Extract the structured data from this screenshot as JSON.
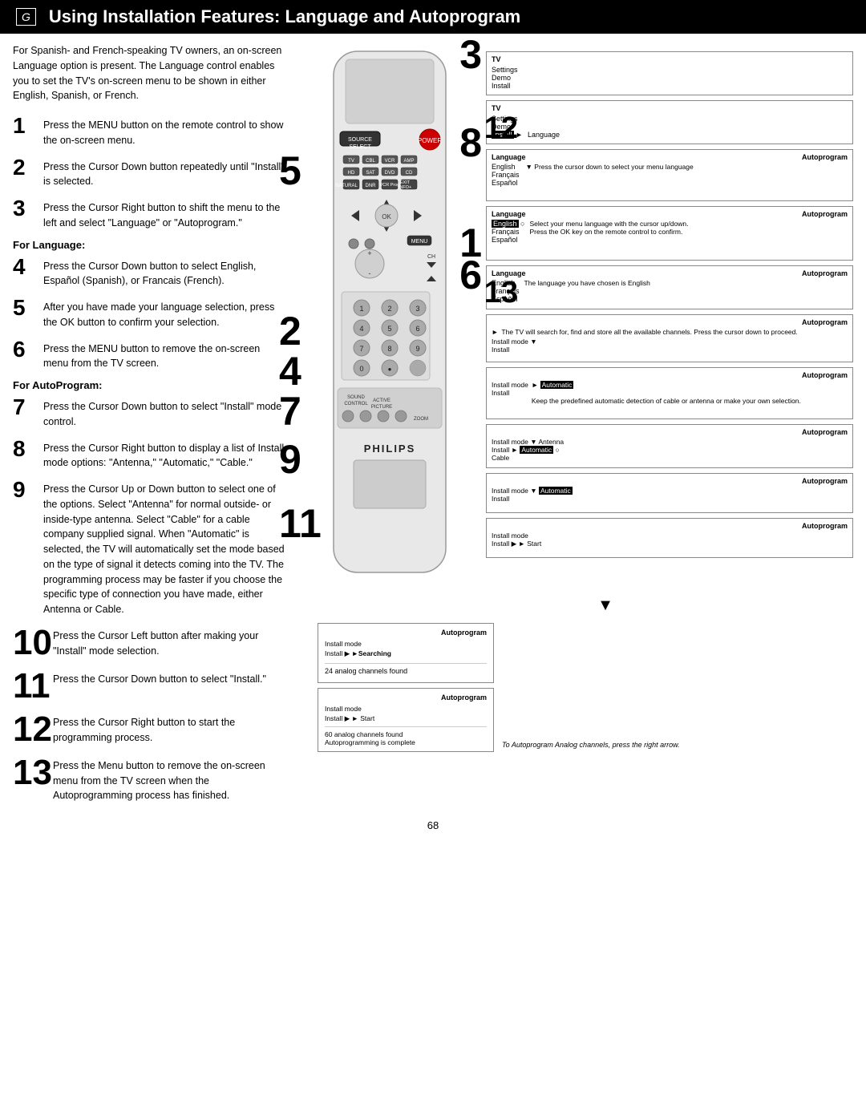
{
  "header": {
    "letter": "G",
    "title": "Using Installation Features: Language and Autoprogram"
  },
  "intro": "For Spanish- and French-speaking TV owners, an on-screen Language option is present. The Language control enables you to set the TV's on-screen menu to be shown in either English, Spanish, or French.",
  "steps": [
    {
      "number": "1",
      "size": "normal",
      "text": "Press the MENU button on the remote control to show the on-screen menu."
    },
    {
      "number": "2",
      "size": "normal",
      "text": "Press the Cursor Down button repeatedly until \"Install\" is selected."
    },
    {
      "number": "3",
      "size": "normal",
      "text": "Press the Cursor Right button to shift the menu to the left and select \"Language\" or \"Autoprogram.\""
    },
    {
      "number": "for_language",
      "label": "For Language:",
      "type": "subheader"
    },
    {
      "number": "4",
      "size": "normal",
      "text": "Press the Cursor Down button to select English, Español (Spanish), or Francais (French)."
    },
    {
      "number": "5",
      "size": "normal",
      "text": "After you have made your language selection, press the OK button to confirm your selection."
    },
    {
      "number": "6",
      "size": "normal",
      "text": "Press the MENU button to remove the on-screen menu from the TV screen."
    },
    {
      "number": "for_autoprogram",
      "label": "For AutoProgram:",
      "type": "subheader"
    },
    {
      "number": "7",
      "size": "normal",
      "text": "Press the Cursor Down button to select \"Install\" mode control."
    },
    {
      "number": "8",
      "size": "normal",
      "text": "Press the Cursor Right button to display a list of Install mode options: \"Antenna,\" \"Automatic,\" \"Cable.\""
    },
    {
      "number": "9",
      "size": "normal",
      "text": "Press the Cursor Up or Down button to select one of the options. Select \"Antenna\" for normal outside- or inside-type antenna. Select \"Cable\" for a cable company supplied signal. When \"Automatic\" is selected, the TV will automatically set the mode based on the type of signal it detects coming into the TV. The programming process may be faster if you choose the specific type of connection you have made, either Antenna or Cable."
    },
    {
      "number": "10",
      "size": "large",
      "text": "Press the Cursor Left button after making your \"Install\" mode selection."
    },
    {
      "number": "11",
      "size": "large",
      "text": "Press the Cursor Down button to select \"Install.\""
    },
    {
      "number": "12",
      "size": "large",
      "text": "Press the Cursor Right button to start the programming process."
    },
    {
      "number": "13",
      "size": "large",
      "text": "Press the Menu button to remove the on-screen menu from the TV screen when the Autoprogramming process has finished."
    }
  ],
  "page_number": "68",
  "menu_screens": [
    {
      "columns": [
        "TV",
        ""
      ],
      "rows": [
        "Settings",
        "Demo",
        "Install"
      ]
    },
    {
      "columns": [
        "TV",
        ""
      ],
      "rows": [
        "Settings",
        "Demo",
        "Install →"
      ],
      "note": "Language"
    },
    {
      "columns": [
        "Language",
        "Autoprogram"
      ],
      "items": [
        "English",
        "Français",
        "Español"
      ],
      "note": "Press the cursor down to select your menu language"
    },
    {
      "columns": [
        "Language",
        "Autoprogram"
      ],
      "items": [
        "English ○",
        "Français",
        "Español"
      ],
      "note": "Select your menu language with the cursor up/down. Press the OK key on the remote control to confirm."
    },
    {
      "columns": [
        "Language",
        "Autoprogram"
      ],
      "items": [
        "English",
        "Français",
        "Español"
      ],
      "note": "The language you have chosen is English"
    }
  ],
  "autoprogram_screens_right": [
    {
      "title": "Autoprogram",
      "install_mode": "",
      "install": "",
      "note": "The TV will search for, find and store all the available channels. Press the cursor down to proceed."
    },
    {
      "title": "Autoprogram",
      "install_mode": "● Automatic",
      "install": "",
      "note": "Keep the predefined automatic detection of cable or antenna or make your own selection."
    },
    {
      "title": "Autoprogram",
      "install_mode": "Antenna",
      "install": "● Automatic",
      "install2": "Cable"
    },
    {
      "title": "Autoprogram",
      "install_mode": "● Automatic",
      "install": "",
      "note2": true
    },
    {
      "title": "Autoprogram",
      "install_mode": "",
      "install_arrow": "→ Start"
    }
  ],
  "autoprogram_screens_bottom_left": [
    {
      "title": "Autoprogram",
      "install_mode": "",
      "install_arrow": "●Searching",
      "found": "24 analog channels found"
    },
    {
      "title": "Autoprogram",
      "install_arrow": "→ Start",
      "found": "60 analog channels found\nAutoprogramming is complete"
    }
  ],
  "bottom_note": "To Autoprogram Analog channels, press the right arrow."
}
